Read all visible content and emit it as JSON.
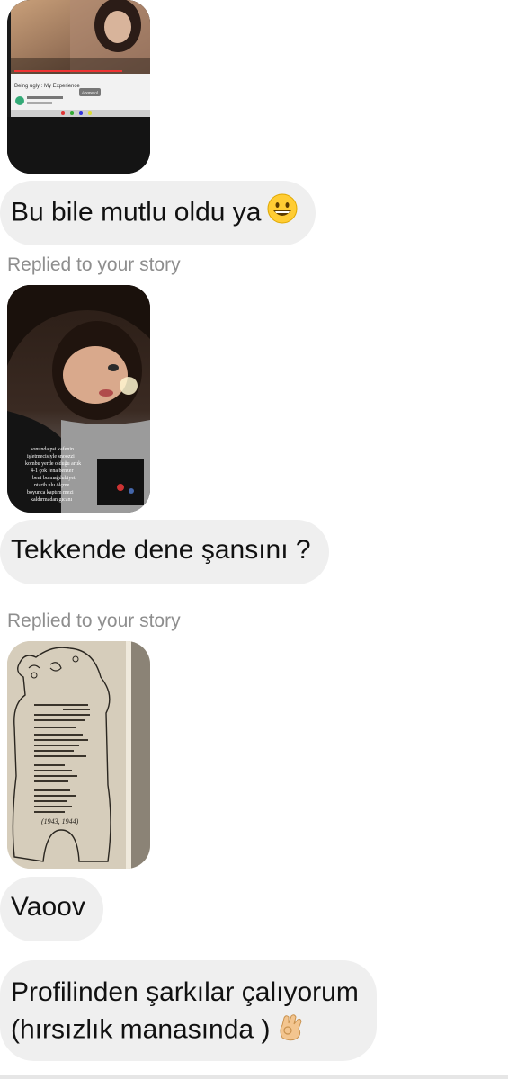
{
  "messages": [
    {
      "kind": "text",
      "text": "Bu bile mutlu oldu ya",
      "emoji": "grinning-face-emoji"
    },
    {
      "kind": "story_reply_label",
      "text": "Replied to your story"
    },
    {
      "kind": "story_image",
      "overlay_lines": [
        "sonunda psi kafenin",
        "işletmecisiyle snoozzi",
        "kombu yerde olduğu artık",
        "4-1 çok fena benzer",
        "beni bu mağdubiyet",
        "ntarih ulu ölçme",
        "boyunca kaptım mezi",
        "kaldırmadan gıcanı"
      ]
    },
    {
      "kind": "text",
      "text": "Tekkende dene şansını ?"
    },
    {
      "kind": "story_reply_label",
      "text": "Replied to your story"
    },
    {
      "kind": "story_image",
      "poem_year": "(1943, 1944)"
    },
    {
      "kind": "text",
      "text": "Vaoov"
    },
    {
      "kind": "text",
      "lines": [
        "Profilinden şarkılar çalıyorum",
        "(hırsızlık manasında )"
      ],
      "emoji": "ok-hand-emoji"
    }
  ],
  "video": {
    "title": "Being ugly : My Experience",
    "subscribe": "Abone ol"
  },
  "colors": {
    "bubble": "#efefef",
    "meta_text": "#8e8e8e",
    "text": "#111111"
  }
}
